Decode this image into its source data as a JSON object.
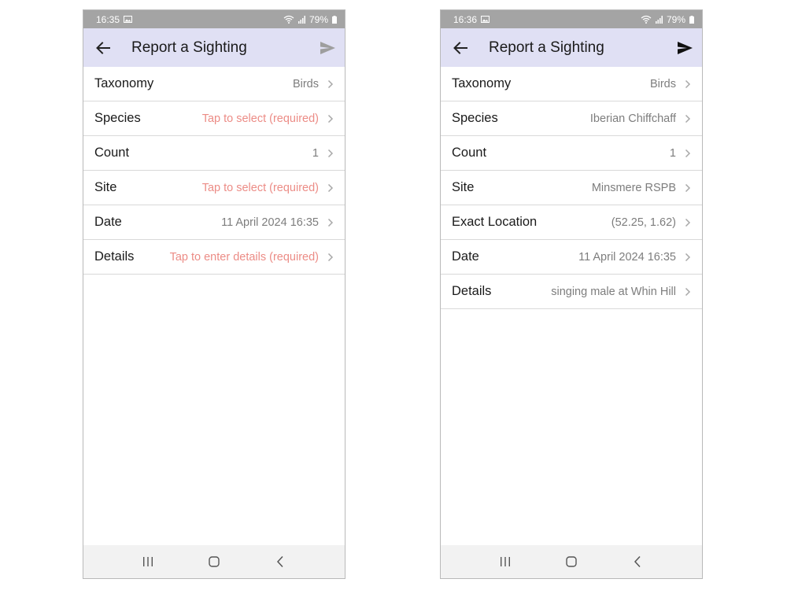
{
  "screens": [
    {
      "status": {
        "time": "16:35",
        "battery": "79%"
      },
      "title": "Report a Sighting",
      "rows": [
        {
          "label": "Taxonomy",
          "value": "Birds",
          "required": false
        },
        {
          "label": "Species",
          "value": "Tap to select (required)",
          "required": true
        },
        {
          "label": "Count",
          "value": "1",
          "required": false
        },
        {
          "label": "Site",
          "value": "Tap to select (required)",
          "required": true
        },
        {
          "label": "Date",
          "value": "11 April 2024 16:35",
          "required": false
        },
        {
          "label": "Details",
          "value": "Tap to enter details (required)",
          "required": true
        }
      ],
      "send_enabled": false
    },
    {
      "status": {
        "time": "16:36",
        "battery": "79%"
      },
      "title": "Report a Sighting",
      "rows": [
        {
          "label": "Taxonomy",
          "value": "Birds",
          "required": false
        },
        {
          "label": "Species",
          "value": "Iberian Chiffchaff",
          "required": false
        },
        {
          "label": "Count",
          "value": "1",
          "required": false
        },
        {
          "label": "Site",
          "value": "Minsmere RSPB",
          "required": false
        },
        {
          "label": "Exact Location",
          "value": "(52.25, 1.62)",
          "required": false
        },
        {
          "label": "Date",
          "value": "11 April 2024 16:35",
          "required": false
        },
        {
          "label": "Details",
          "value": "singing male at Whin Hill",
          "required": false
        }
      ],
      "send_enabled": true
    }
  ],
  "colors": {
    "status_bar": "#a4a4a4",
    "app_bar": "#e0e0f4",
    "required_text": "#ec8c86",
    "value_text": "#7d7d7d",
    "send_disabled": "#9e9e9e",
    "send_enabled": "#111111",
    "nav_bar": "#f2f2f2"
  },
  "icons": {
    "back": "arrow-left-icon",
    "send": "send-icon",
    "chevron": "chevron-right-icon",
    "nav_recents": "recents-icon",
    "nav_home": "home-icon",
    "nav_back": "back-nav-icon"
  }
}
